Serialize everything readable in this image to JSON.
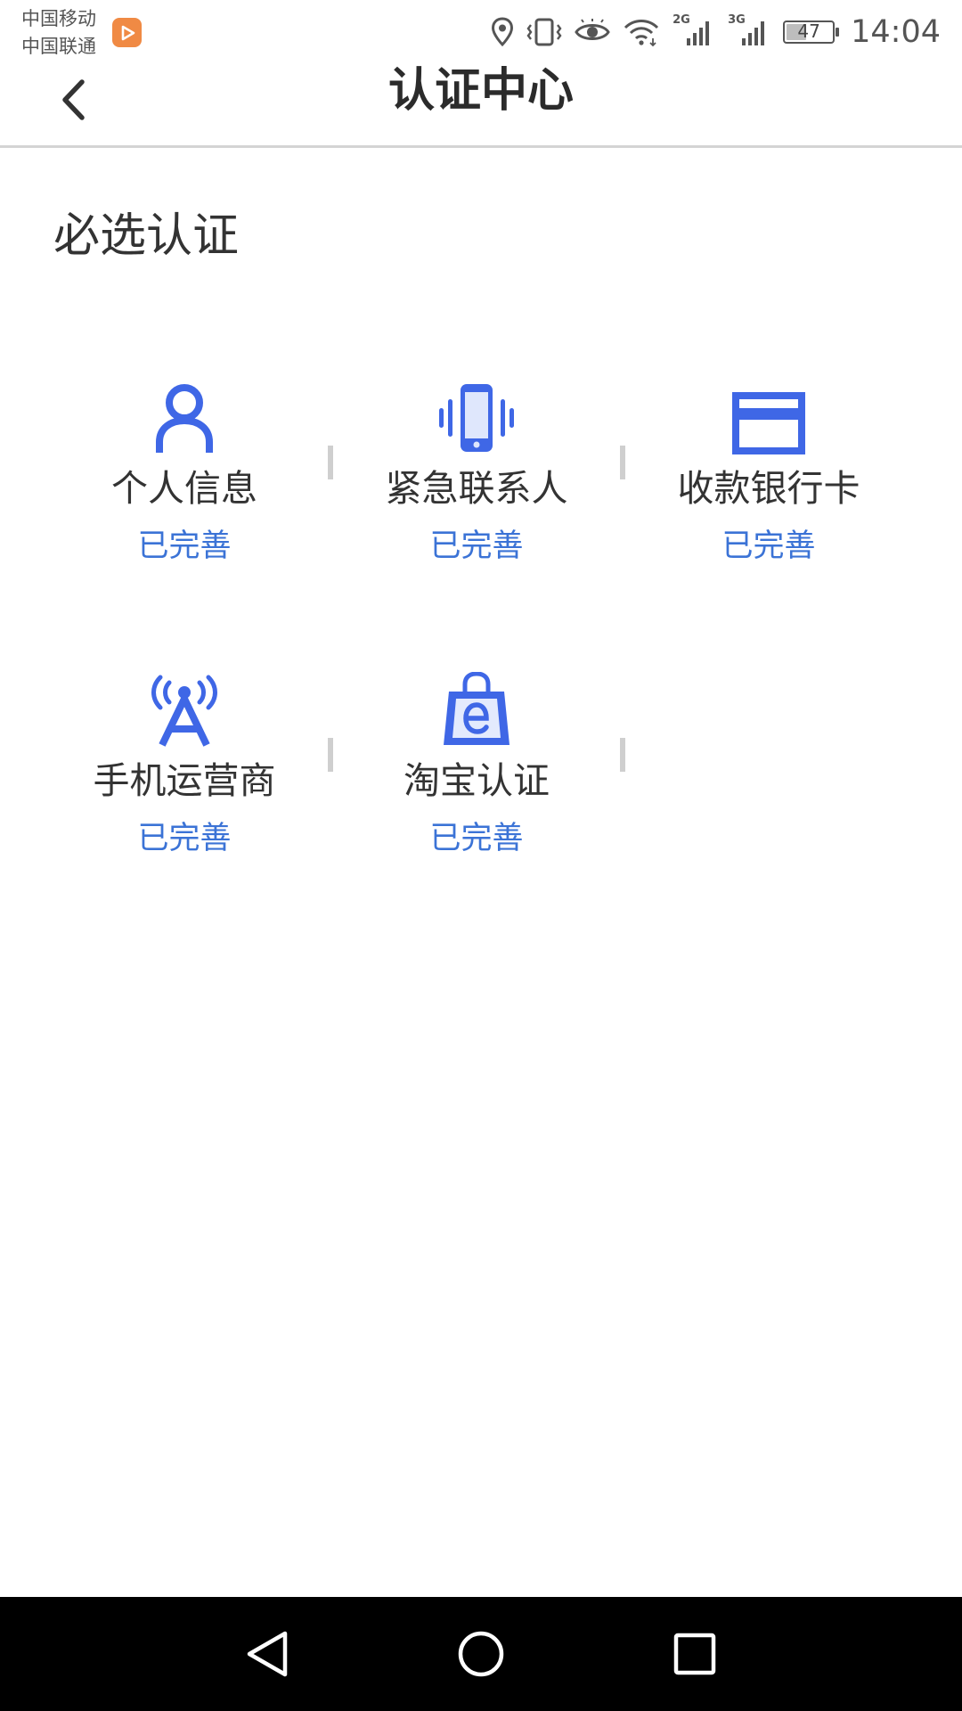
{
  "status_bar": {
    "carrier_1": "中国移动",
    "carrier_2": "中国联通",
    "network_1": "2G",
    "network_2": "3G",
    "battery_level": 47,
    "battery_text": "47",
    "time": "14:04"
  },
  "header": {
    "title": "认证中心"
  },
  "section": {
    "title": "必选认证"
  },
  "certifications": [
    {
      "name": "个人信息",
      "status": "已完善",
      "icon": "person-icon"
    },
    {
      "name": "紧急联系人",
      "status": "已完善",
      "icon": "vibrating-phone-icon"
    },
    {
      "name": "收款银行卡",
      "status": "已完善",
      "icon": "bank-card-icon"
    },
    {
      "name": "手机运营商",
      "status": "已完善",
      "icon": "signal-tower-icon"
    },
    {
      "name": "淘宝认证",
      "status": "已完善",
      "icon": "shopping-bag-icon"
    }
  ],
  "colors": {
    "accent": "#3b73d6",
    "icon_blue": "#3f67e6",
    "carrier_badge": "#f08a44"
  }
}
